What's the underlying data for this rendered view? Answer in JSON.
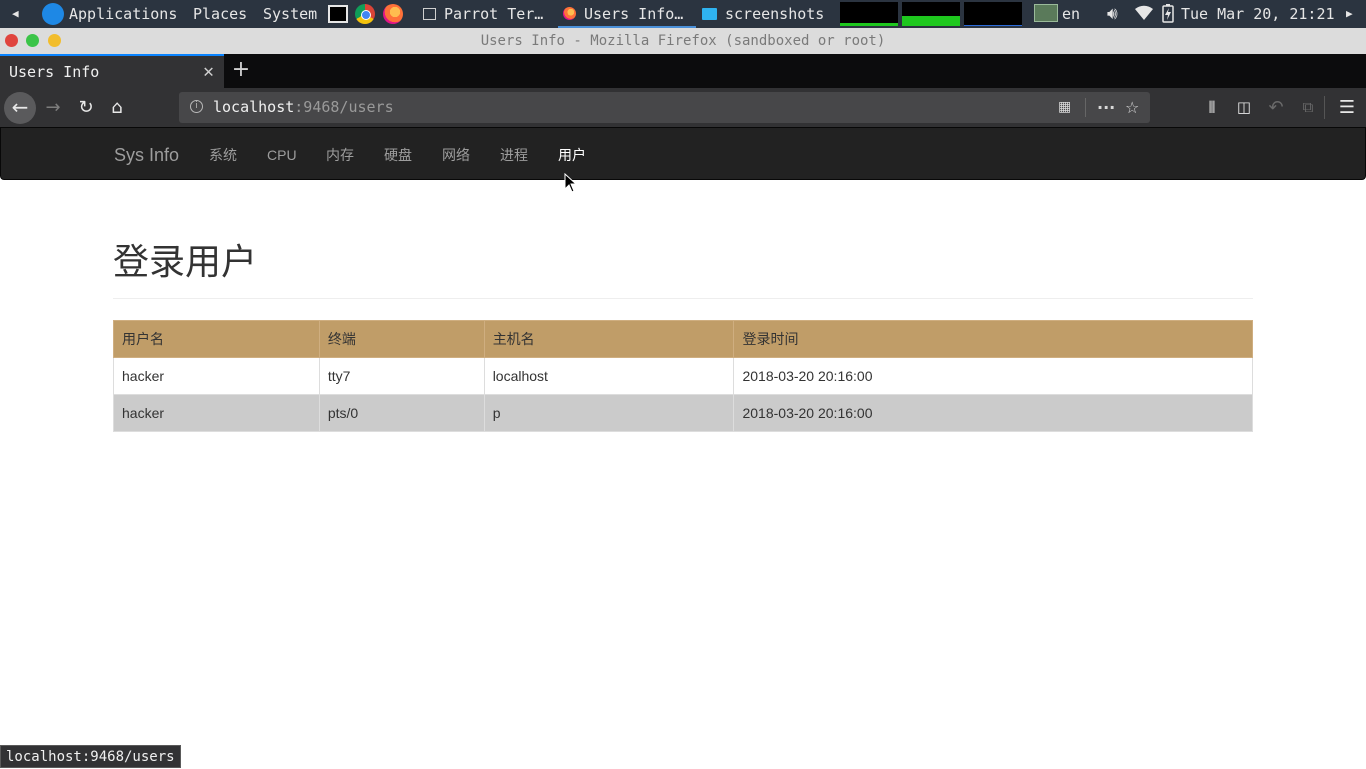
{
  "system_panel": {
    "applications_label": "Applications",
    "places_label": "Places",
    "system_label": "System",
    "tasks": [
      {
        "label": "Parrot Ter…"
      },
      {
        "label": "Users Info…"
      },
      {
        "label": "screenshots"
      }
    ],
    "keyboard_layout": "en",
    "clock": "Tue Mar 20, 21:21"
  },
  "window": {
    "title": "Users Info - Mozilla Firefox (sandboxed or root)"
  },
  "browser": {
    "tab_title": "Users Info",
    "url_host": "localhost",
    "url_rest": ":9468/users",
    "status_url": "localhost:9468/users"
  },
  "app": {
    "brand": "Sys Info",
    "nav": [
      {
        "label": "系统"
      },
      {
        "label": "CPU"
      },
      {
        "label": "内存"
      },
      {
        "label": "硬盘"
      },
      {
        "label": "网络"
      },
      {
        "label": "进程"
      },
      {
        "label": "用户",
        "active": true
      }
    ],
    "page_title": "登录用户",
    "table": {
      "headers": [
        "用户名",
        "终端",
        "主机名",
        "登录时间"
      ],
      "rows": [
        [
          "hacker",
          "tty7",
          "localhost",
          "2018-03-20 20:16:00"
        ],
        [
          "hacker",
          "pts/0",
          "p",
          "2018-03-20 20:16:00"
        ]
      ]
    }
  },
  "colors": {
    "table_header": "#c09d68",
    "row_even": "#cbcbcb",
    "navbar": "#222222",
    "accent": "#0a84ff"
  }
}
